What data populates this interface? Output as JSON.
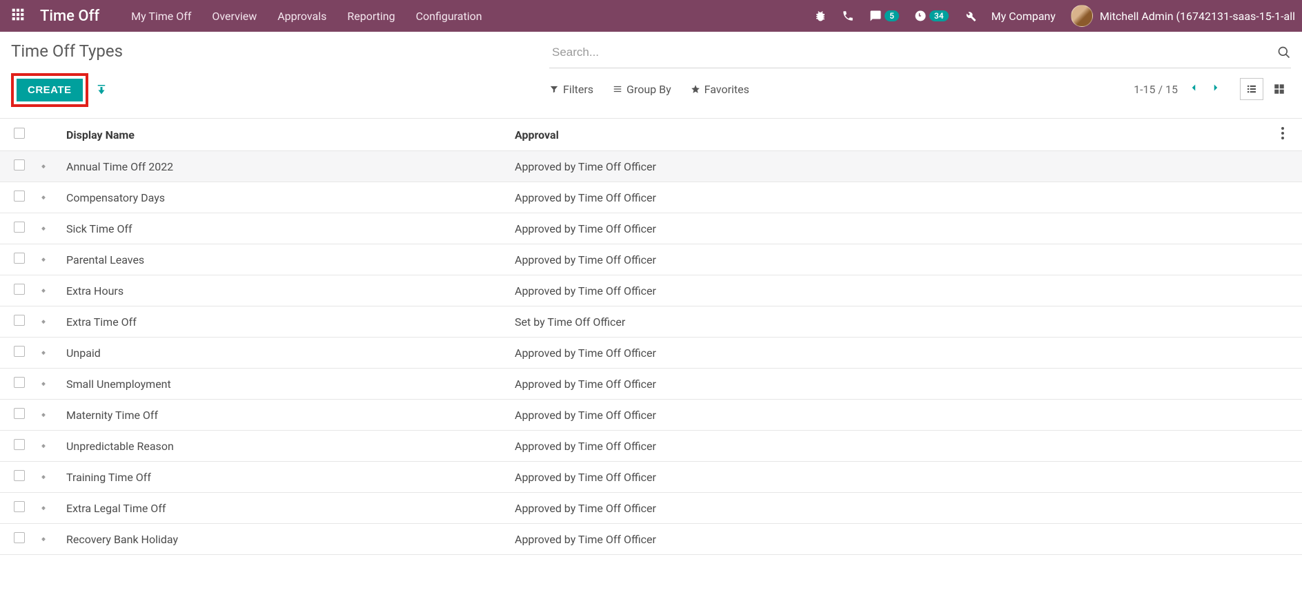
{
  "navbar": {
    "brand": "Time Off",
    "menu": [
      "My Time Off",
      "Overview",
      "Approvals",
      "Reporting",
      "Configuration"
    ],
    "messages_count": "5",
    "activities_count": "34",
    "company": "My Company",
    "user": "Mitchell Admin (16742131-saas-15-1-all"
  },
  "control": {
    "title": "Time Off Types",
    "create_label": "CREATE",
    "search_placeholder": "Search...",
    "filters_label": "Filters",
    "groupby_label": "Group By",
    "favorites_label": "Favorites",
    "pager": "1-15 / 15"
  },
  "table": {
    "columns": {
      "name": "Display Name",
      "approval": "Approval"
    },
    "rows": [
      {
        "name": "Annual Time Off 2022",
        "approval": "Approved by Time Off Officer"
      },
      {
        "name": "Compensatory Days",
        "approval": "Approved by Time Off Officer"
      },
      {
        "name": "Sick Time Off",
        "approval": "Approved by Time Off Officer"
      },
      {
        "name": "Parental Leaves",
        "approval": "Approved by Time Off Officer"
      },
      {
        "name": "Extra Hours",
        "approval": "Approved by Time Off Officer"
      },
      {
        "name": "Extra Time Off",
        "approval": "Set by Time Off Officer"
      },
      {
        "name": "Unpaid",
        "approval": "Approved by Time Off Officer"
      },
      {
        "name": "Small Unemployment",
        "approval": "Approved by Time Off Officer"
      },
      {
        "name": "Maternity Time Off",
        "approval": "Approved by Time Off Officer"
      },
      {
        "name": "Unpredictable Reason",
        "approval": "Approved by Time Off Officer"
      },
      {
        "name": "Training Time Off",
        "approval": "Approved by Time Off Officer"
      },
      {
        "name": "Extra Legal Time Off",
        "approval": "Approved by Time Off Officer"
      },
      {
        "name": "Recovery Bank Holiday",
        "approval": "Approved by Time Off Officer"
      }
    ]
  }
}
